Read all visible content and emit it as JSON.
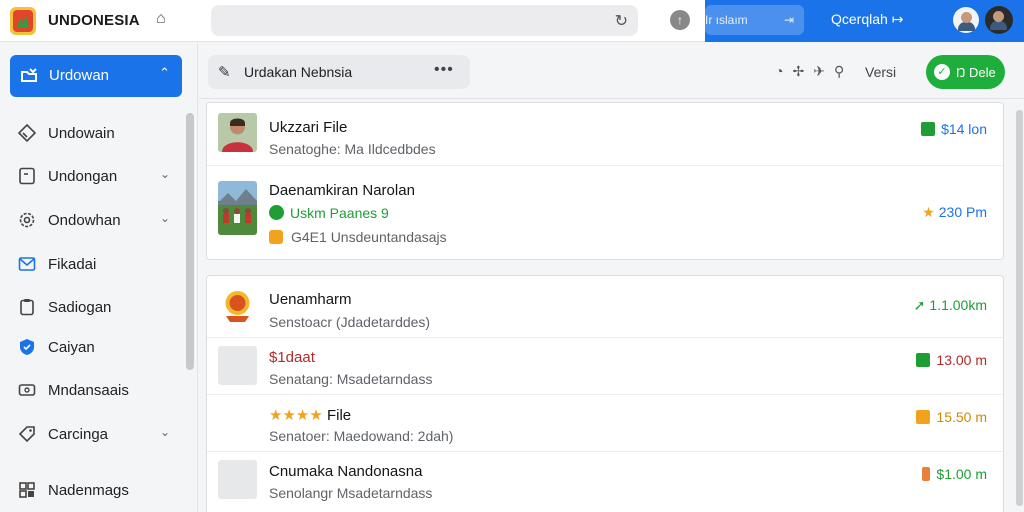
{
  "header": {
    "brand": "UNDONESIA",
    "blue_pill": "Ir ıslaım",
    "search_link": "Qcerqlah ↦"
  },
  "sidebar": {
    "active": {
      "label": "Urdowan"
    },
    "items": [
      {
        "label": "Undowain"
      },
      {
        "label": "Undongan"
      },
      {
        "label": "Ondowhan"
      },
      {
        "label": "Fikadai"
      },
      {
        "label": "Sadiogan"
      },
      {
        "label": "Caiyan"
      },
      {
        "label": "Mndansaais"
      },
      {
        "label": "Carcinga"
      },
      {
        "label": "Nadenmags"
      }
    ]
  },
  "main": {
    "breadcrumb": "Urdakan Nebnsia",
    "more": "•••",
    "versi_label": "Versi",
    "primary_button": "Ŋ Dele",
    "card1": [
      {
        "title": "Ukzzari File",
        "sub": "Senatoghe: Ma Ildcedbdes",
        "value": "$14 lon",
        "value_color": "#1e9e35"
      },
      {
        "title": "Daenamkiran Narolan",
        "green": "Uskm Paanes 9",
        "meta": "G4E1 Unsdeuntandasajs",
        "value": "230 Pm",
        "value_color": "#1a73e8"
      }
    ],
    "card2": [
      {
        "title": "Uenamharm",
        "sub": "Senstoacr (Jdadetarddes)",
        "value": "1.1.00km",
        "value_color": "#1e9e35"
      },
      {
        "title": "$1daat",
        "sub": "Senatang: Msadetarndass",
        "value": "13.00 m",
        "value_color": "#b22a2a"
      },
      {
        "title": "★★★★ File",
        "sub": "Senatoer: Maedowand: 2dah)",
        "value": "15.50 m",
        "value_color": "#d48a00"
      },
      {
        "title": "Cnumaka Nandonasna",
        "sub": "Senolangr Msadetarndass",
        "value": "$1.00 m",
        "value_color": "#1e9e35"
      }
    ]
  }
}
